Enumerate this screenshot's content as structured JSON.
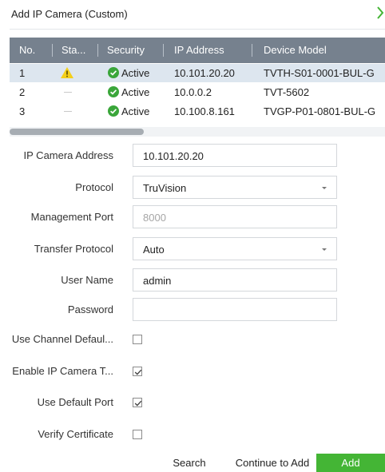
{
  "window": {
    "title": "Add IP Camera (Custom)"
  },
  "table": {
    "columns": [
      "No.",
      "Sta...",
      "Security",
      "IP Address",
      "Device Model"
    ],
    "rows": [
      {
        "no": "1",
        "status": "warning-icon",
        "security": "Active",
        "ip": "10.101.20.20",
        "model": "TVTH-S01-0001-BUL-G"
      },
      {
        "no": "2",
        "status": "dash",
        "security": "Active",
        "ip": "10.0.0.2",
        "model": "TVT-5602"
      },
      {
        "no": "3",
        "status": "dash",
        "security": "Active",
        "ip": "10.100.8.161",
        "model": "TVGP-P01-0801-BUL-G"
      }
    ],
    "selected_row": 0
  },
  "form": {
    "ip_address": {
      "label": "IP Camera Address",
      "value": "10.101.20.20"
    },
    "protocol": {
      "label": "Protocol",
      "value": "TruVision"
    },
    "management_port": {
      "label": "Management Port",
      "placeholder": "8000"
    },
    "transfer_protocol": {
      "label": "Transfer Protocol",
      "value": "Auto"
    },
    "user_name": {
      "label": "User Name",
      "value": "admin"
    },
    "password": {
      "label": "Password",
      "value": ""
    },
    "use_channel_default": {
      "label": "Use Channel Defaul...",
      "checked": false
    },
    "enable_ip_camera": {
      "label": "Enable IP Camera T...",
      "checked": true
    },
    "use_default_port": {
      "label": "Use Default Port",
      "checked": true
    },
    "verify_certificate": {
      "label": "Verify Certificate",
      "checked": false
    }
  },
  "buttons": {
    "search": "Search",
    "continue": "Continue to Add",
    "add": "Add"
  },
  "colors": {
    "header": "#76818e",
    "selected_row": "#dde6ef",
    "active_green": "#3aa63a",
    "warning": "#f4cf1a",
    "add_button": "#44b535",
    "chevron": "#44b535"
  }
}
